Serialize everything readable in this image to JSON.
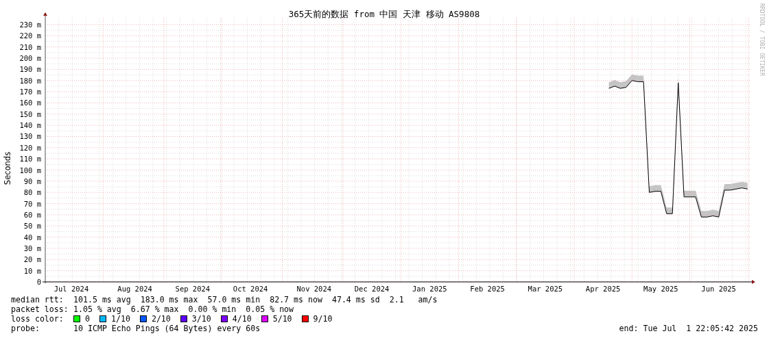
{
  "title": "365天前的数据 from 中国 天津 移动 AS9808",
  "chart": {
    "chart_data": {
      "type": "line",
      "grid": true,
      "ylabel": "Seconds",
      "ylim": [
        0,
        237
      ],
      "categories": [
        null,
        null,
        null,
        null,
        "Jul 2024",
        null,
        null,
        null,
        null,
        null,
        null,
        null,
        null,
        null,
        null,
        "Aug 2024",
        null,
        null,
        null,
        null,
        null,
        null,
        null,
        null,
        null,
        "Sep 2024",
        null,
        null,
        null,
        null,
        null,
        null,
        null,
        null,
        null,
        "Oct 2024",
        null,
        null,
        null,
        null,
        null,
        null,
        null,
        null,
        null,
        null,
        "Nov 2024",
        null,
        null,
        null,
        null,
        null,
        null,
        null,
        null,
        null,
        "Dec 2024",
        null,
        null,
        null,
        null,
        null,
        null,
        null,
        null,
        null,
        "Jan 2025",
        null,
        null,
        null,
        null,
        null,
        null,
        null,
        null,
        null,
        "Feb 2025",
        null,
        null,
        null,
        null,
        null,
        null,
        null,
        null,
        null,
        "Mar 2025",
        null,
        null,
        null,
        null,
        null,
        null,
        null,
        null,
        null,
        "Apr 2025",
        null,
        null,
        null,
        null,
        null,
        null,
        null,
        null,
        null,
        "May 2025",
        null,
        null,
        null,
        null,
        null,
        null,
        null,
        null,
        null,
        "Jun 2025",
        null,
        null,
        null,
        null,
        null
      ],
      "series": [
        {
          "name": "median rtt:",
          "color": "#000000",
          "values": [
            null,
            null,
            null,
            null,
            null,
            null,
            null,
            null,
            null,
            null,
            null,
            null,
            null,
            null,
            null,
            null,
            null,
            null,
            null,
            null,
            null,
            null,
            null,
            null,
            null,
            null,
            null,
            null,
            null,
            null,
            null,
            null,
            null,
            null,
            null,
            null,
            null,
            null,
            null,
            null,
            null,
            null,
            null,
            null,
            null,
            null,
            null,
            null,
            null,
            null,
            null,
            null,
            null,
            null,
            null,
            null,
            null,
            null,
            null,
            null,
            null,
            null,
            null,
            null,
            null,
            null,
            null,
            null,
            null,
            null,
            null,
            null,
            null,
            null,
            null,
            null,
            null,
            null,
            null,
            null,
            null,
            null,
            null,
            null,
            null,
            null,
            null,
            null,
            null,
            null,
            null,
            null,
            null,
            null,
            null,
            null,
            null,
            173,
            175,
            173,
            174,
            180,
            179,
            179,
            80,
            81,
            81,
            61,
            61,
            178,
            76,
            76,
            76,
            58,
            58,
            59,
            58,
            82,
            82,
            83,
            84,
            83
          ]
        }
      ],
      "yticks": [
        {
          "value": 0,
          "label": "0"
        },
        {
          "value": 10,
          "label": "10 m"
        },
        {
          "value": 20,
          "label": "20 m"
        },
        {
          "value": 30,
          "label": "30 m"
        },
        {
          "value": 40,
          "label": "40 m"
        },
        {
          "value": 50,
          "label": "50 m"
        },
        {
          "value": 60,
          "label": "60 m"
        },
        {
          "value": 70,
          "label": "70 m"
        },
        {
          "value": 80,
          "label": "80 m"
        },
        {
          "value": 90,
          "label": "90 m"
        },
        {
          "value": 100,
          "label": "100 m"
        },
        {
          "value": 110,
          "label": "110 m"
        },
        {
          "value": 120,
          "label": "120 m"
        },
        {
          "value": 130,
          "label": "130 m"
        },
        {
          "value": 140,
          "label": "140 m"
        },
        {
          "value": 150,
          "label": "150 m"
        },
        {
          "value": 160,
          "label": "160 m"
        },
        {
          "value": 170,
          "label": "170 m"
        },
        {
          "value": 180,
          "label": "180 m"
        },
        {
          "value": 190,
          "label": "190 m"
        },
        {
          "value": 200,
          "label": "200 m"
        },
        {
          "value": 210,
          "label": "210 m"
        },
        {
          "value": 220,
          "label": "220 m"
        },
        {
          "value": 230,
          "label": "230 m"
        }
      ]
    },
    "credit": "RRDTOOL / TOBI OETIKER"
  },
  "legend": {
    "median": {
      "text": "101.5 ms avg  183.0 ms max  57.0 ms min  82.7 ms now  47.4 ms sd  2.1   am/s"
    },
    "loss": {
      "label": "packet loss:",
      "text": "1.05 % avg  6.67 % max  0.00 % min  0.05 % now"
    },
    "loss_color": {
      "label": "loss color:",
      "items": [
        {
          "label": "0",
          "color": "#00ff00"
        },
        {
          "label": "1/10",
          "color": "#00b8ff"
        },
        {
          "label": "2/10",
          "color": "#0059ff"
        },
        {
          "label": "3/10",
          "color": "#5e00ff"
        },
        {
          "label": "4/10",
          "color": "#7e00ff"
        },
        {
          "label": "5/10",
          "color": "#dd00ff"
        },
        {
          "label": "9/10",
          "color": "#ff0000"
        }
      ]
    },
    "probe": {
      "label": "probe:",
      "text": "10 ICMP Echo Pings (64 Bytes) every 60s"
    },
    "end": "end: Tue Jul  1 22:05:42 2025"
  }
}
